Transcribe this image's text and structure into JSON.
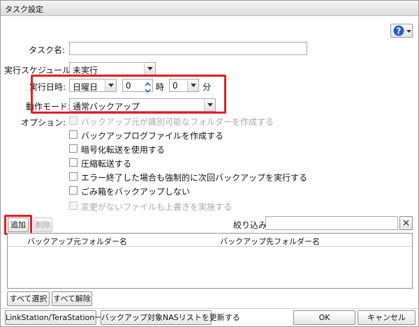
{
  "window": {
    "title": "タスク設定"
  },
  "help": {
    "icon": "help-icon"
  },
  "form": {
    "task_name_label": "タスク名:",
    "task_name_value": "",
    "schedule_label": "実行スケジュール:",
    "schedule_value": "未実行",
    "datetime_label": "実行日時:",
    "day_value": "日曜日",
    "hour_value": "0",
    "hour_unit": "時",
    "minute_value": "0",
    "minute_unit": "分",
    "mode_label": "動作モード:",
    "mode_value": "通常バックアップ",
    "options_label": "オプション:"
  },
  "options": [
    {
      "label": "バックアップ元が識別可能なフォルダーを作成する",
      "enabled": false,
      "checked": false
    },
    {
      "label": "バックアップログファイルを作成する",
      "enabled": true,
      "checked": false
    },
    {
      "label": "暗号化転送を使用する",
      "enabled": true,
      "checked": false
    },
    {
      "label": "圧縮転送する",
      "enabled": true,
      "checked": false
    },
    {
      "label": "エラー終了した場合も強制的に次回バックアップを実行する",
      "enabled": true,
      "checked": false
    },
    {
      "label": "ごみ箱をバックアップしない",
      "enabled": true,
      "checked": false
    },
    {
      "label": "変更がないファイルも上書きを実施する",
      "enabled": false,
      "checked": false
    }
  ],
  "folders": {
    "add_label": "追加",
    "delete_label": "削除",
    "filter_label": "絞り込み:",
    "filter_value": "",
    "columns": [
      "バックアップ元フォルダー名",
      "バックアップ先フォルダー名"
    ],
    "rows": [],
    "select_all_label": "すべて選択",
    "deselect_all_label": "すべて解除"
  },
  "footer": {
    "list_label": "LinkStation/TeraStation一覧",
    "refresh_label": "バックアップ対象NASリストを更新する",
    "ok_label": "OK",
    "cancel_label": "キャンセル"
  },
  "colors": {
    "highlight": "#e01e26",
    "help_blue": "#1f5fbf"
  }
}
